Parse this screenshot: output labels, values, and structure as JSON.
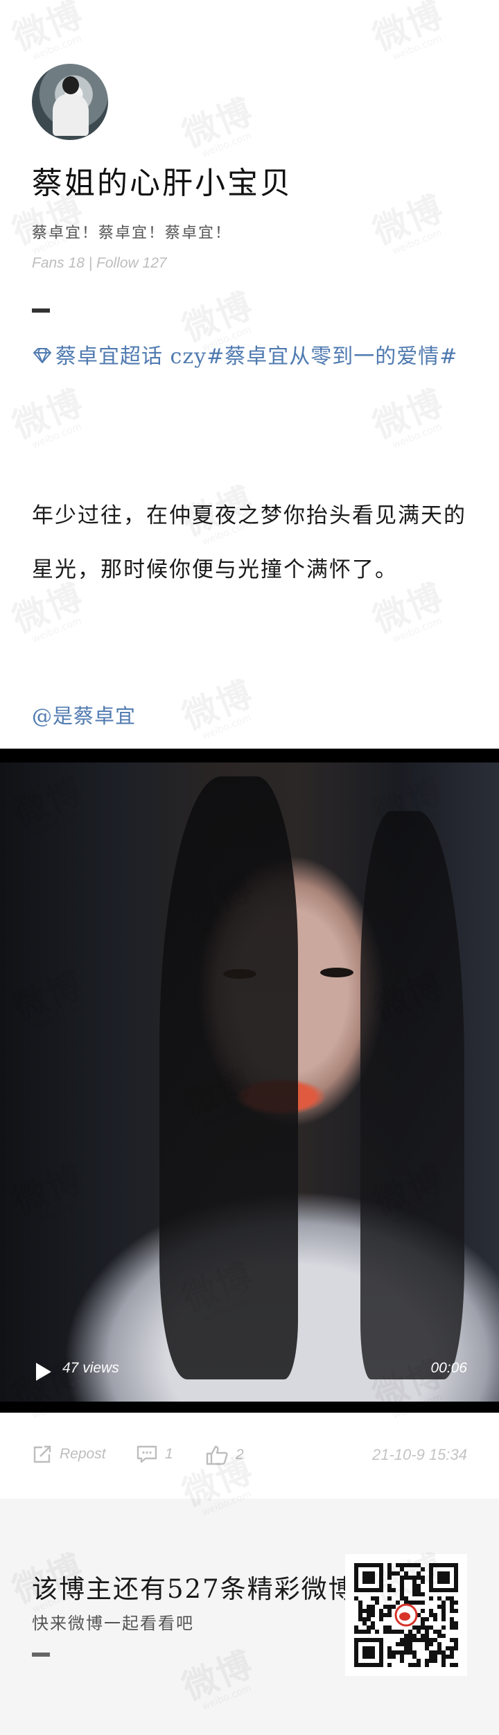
{
  "profile": {
    "username": "蔡姐的心肝小宝贝",
    "bio": "蔡卓宜！蔡卓宜！蔡卓宜！",
    "stats": "Fans 18 | Follow 127"
  },
  "post": {
    "topic_line": "蔡卓宜超话 czy#蔡卓宜从零到一的爱情#",
    "body": "年少过往，在仲夏夜之梦你抬头看见满天的星光，那时候你便与光撞个满怀了。",
    "mention": "@是蔡卓宜"
  },
  "video": {
    "views": "47 views",
    "duration": "00:06"
  },
  "actions": {
    "repost": "Repost",
    "comments": "1",
    "likes": "2",
    "timestamp": "21-10-9 15:34"
  },
  "footer": {
    "title": "该博主还有527条精彩微博",
    "subtitle": "快来微博一起看看吧"
  },
  "watermark": {
    "brand": "微博",
    "domain": "weibo.com"
  },
  "colors": {
    "link": "#4f7ab0",
    "footer_bg": "#f5f5f5"
  },
  "icons": [
    "gem-icon",
    "play-icon",
    "repost-icon",
    "comment-icon",
    "like-icon",
    "qr-code"
  ]
}
